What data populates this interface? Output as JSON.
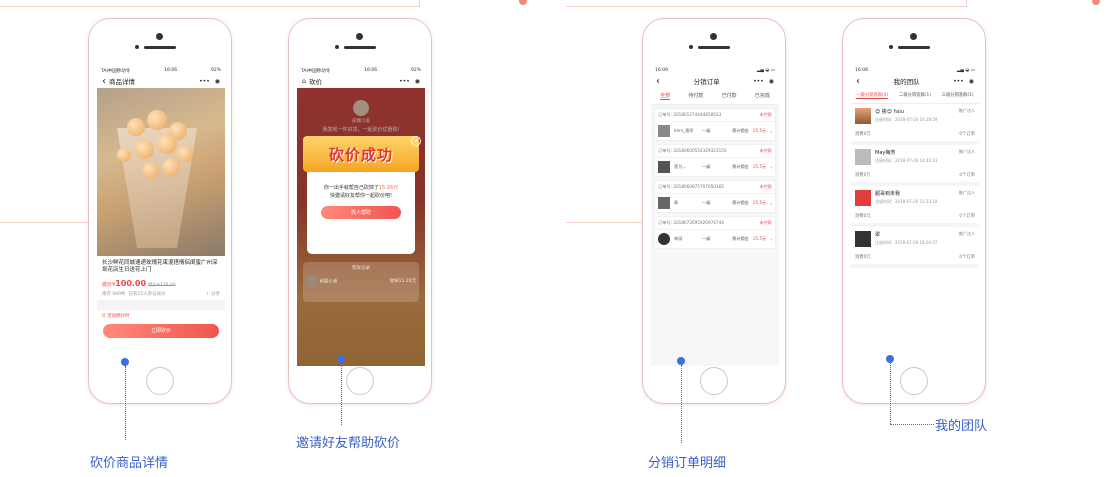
{
  "captions": {
    "c1": "砍价商品详情",
    "c2": "邀请好友帮助砍价",
    "c3": "分销订单明细",
    "c4": "我的团队"
  },
  "phone1": {
    "status_left": "TAI中国移动令",
    "status_time": "16:06",
    "status_right": "92%",
    "title": "商品详情",
    "back_icon": "‹",
    "more_icon": "•••",
    "target_icon": "◉",
    "product_title": "长沙鲜花同城速递玫瑰花束混搭情侣闺蜜广州深圳花店生日送花上门",
    "price_label": "底价¥",
    "price": "100.00",
    "orig_price": "原价¥178.00",
    "stock": "库存 999件",
    "joined": "已有15人参与砍价",
    "share": "分享",
    "countdown": "活动倒计时",
    "cta": "立即砍价"
  },
  "phone2": {
    "status_left": "TAI中国移动令",
    "status_time": "16:06",
    "status_right": "92%",
    "title": "砍价",
    "user_name": "前端小美",
    "headline": "我发现一件好货，一起砍价优惠购!",
    "success_text": "砍价成功",
    "close_icon": "×",
    "line1_pre": "你一出手就帮自己砍掉了",
    "line1_amount": "15.26元",
    "line2": "快邀请好友帮你一起砍价吧!",
    "button": "找人帮砍",
    "record_title": "帮砍记录",
    "record_name": "前端小美",
    "record_amount": "砍掉15.26元"
  },
  "phone3": {
    "status_time": "16:09",
    "title": "分销订单",
    "tabs": [
      "全部",
      "待付款",
      "已付款",
      "已完成"
    ],
    "order_label": "订单号",
    "status": "未付款",
    "level": "一级",
    "commission": "预计佣金",
    "orders": [
      {
        "no": "2018012744448585S3",
        "buyer": "lmrs_渔军",
        "money": "15.5元"
      },
      {
        "no": "2018060055432932315S",
        "buyer": "黑凡...",
        "money": "15.5元"
      },
      {
        "no": "2018060975707050165",
        "buyer": "翠",
        "money": "15.5元"
      },
      {
        "no": "2018072695920974744",
        "buyer": "林伢",
        "money": "15.5元"
      }
    ]
  },
  "phone4": {
    "status_time": "16:08",
    "title": "我的团队",
    "tabs": [
      "一级分销客群(4)",
      "二级分销客群(1)",
      "三级分销客群(1)"
    ],
    "tag": "推广达人",
    "consume_label": "消费0元",
    "orders_label": "0个订单",
    "members": [
      {
        "name": "😊 挨😊 hsiu",
        "date": "注册时间：2018-07-26 16:28:59"
      },
      {
        "name": "May梅芳",
        "date": "注册时间：2018-07-26 14:46:23"
      },
      {
        "name": "超哥到未我",
        "date": "注册时间：2018-07-26 12:33:18"
      },
      {
        "name": "翠",
        "date": "注册时间：2018-07-26 18:04:37"
      }
    ]
  }
}
